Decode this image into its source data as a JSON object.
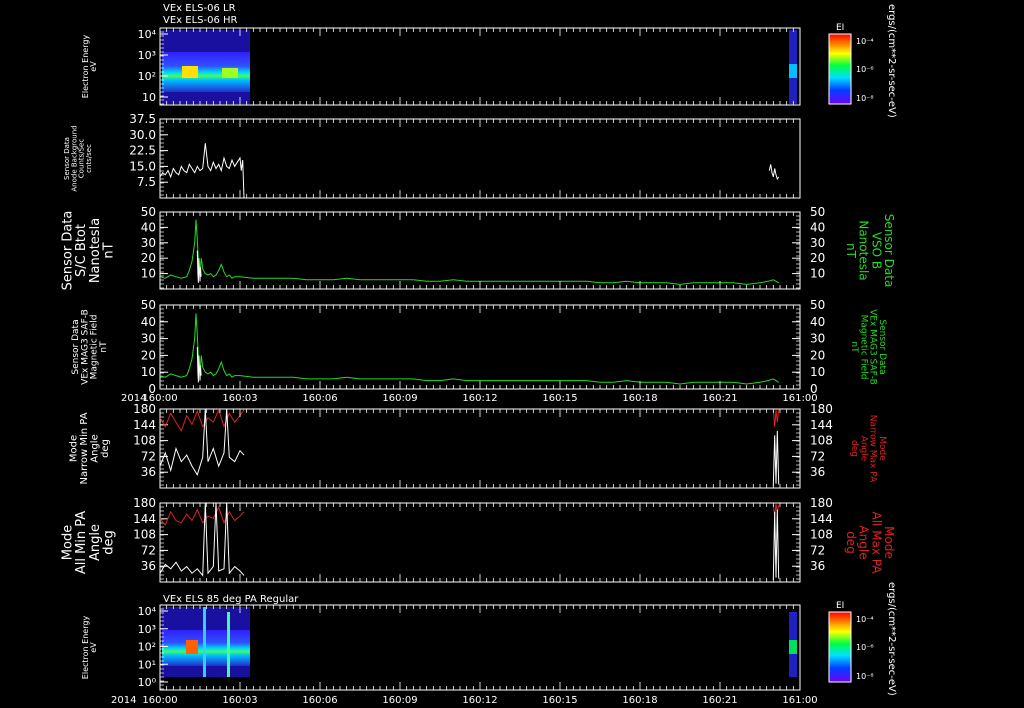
{
  "colors": {
    "background": "#000000",
    "axis": "#ffffff",
    "green": "#22dd22",
    "red": "#dd2222",
    "white": "#ffffff"
  },
  "header": {
    "line1": "VEx ELS-06 LR",
    "line2": "VEx ELS-06 HR"
  },
  "time_axis": {
    "year": "2014",
    "tick_labels": [
      "160:00",
      "160:03",
      "160:06",
      "160:09",
      "160:12",
      "160:15",
      "160:18",
      "160:21",
      "161:00"
    ]
  },
  "colorbar_units": "ergs/(cm**2-sr-sec-eV)",
  "chart_data": [
    {
      "type": "heatmap",
      "id": "els06",
      "ylabel": [
        "Electron Energy",
        "eV"
      ],
      "yticks": [
        "10⁴",
        "10³",
        "10²",
        "10"
      ],
      "colorbar": {
        "label": "EI",
        "ticks": [
          "10⁻⁴",
          "10⁻⁶",
          "10⁻⁸"
        ]
      }
    },
    {
      "type": "line",
      "id": "background",
      "ylabel": [
        "Sensor Data",
        "Anode Background",
        "Counts/Sec",
        "cnts/sec"
      ],
      "ylim": [
        0,
        37.5
      ],
      "yticks": [
        "37.5",
        "30.0",
        "22.5",
        "15.0",
        "7.5"
      ],
      "series": [
        {
          "color": "white",
          "x": [
            0,
            0.1,
            0.2,
            0.3,
            0.4,
            0.5,
            0.6,
            0.7,
            0.8,
            0.9,
            1.0,
            1.1,
            1.2,
            1.3,
            1.4,
            1.5,
            1.6,
            1.7,
            1.8,
            1.9,
            2.0,
            2.1,
            2.2,
            2.3,
            2.4,
            2.5,
            2.6,
            2.7,
            2.8,
            2.9,
            3.0,
            3.05,
            3.1,
            3.15
          ],
          "y": [
            10,
            12,
            11,
            13,
            10,
            14,
            12,
            11,
            15,
            13,
            12,
            16,
            14,
            12,
            15,
            13,
            14,
            26,
            15,
            13,
            17,
            14,
            16,
            13,
            19,
            15,
            14,
            18,
            15,
            17,
            19,
            13,
            18,
            0
          ]
        },
        {
          "color": "white",
          "x": [
            22.85,
            22.9,
            22.95,
            23.0,
            23.05,
            23.1,
            23.15,
            23.2
          ],
          "y": [
            13,
            16,
            12,
            10,
            14,
            11,
            9,
            10
          ]
        }
      ]
    },
    {
      "type": "line",
      "id": "bmag",
      "ylabel": [
        "Sensor Data",
        "S/C Btot",
        "Nanotesla",
        "nT"
      ],
      "ylabel_right": [
        "Sensor Data",
        "VSO B",
        "Nanotesla",
        "nT"
      ],
      "ylim": [
        0,
        50
      ],
      "yticks": [
        "50",
        "40",
        "30",
        "20",
        "10"
      ],
      "series": [
        {
          "color": "green",
          "x": [
            0,
            0.2,
            0.4,
            0.6,
            0.8,
            1.0,
            1.1,
            1.2,
            1.3,
            1.35,
            1.4,
            1.45,
            1.5,
            1.55,
            1.6,
            1.7,
            1.8,
            1.9,
            2.0,
            2.1,
            2.2,
            2.3,
            2.4,
            2.5,
            2.6,
            2.7,
            2.8,
            3.0,
            3.5,
            4,
            4.5,
            5,
            5.5,
            6,
            6.5,
            7,
            7.5,
            8,
            8.5,
            9,
            9.5,
            10,
            10.5,
            11,
            11.5,
            12,
            12.5,
            13,
            13.5,
            14,
            14.5,
            15,
            15.5,
            16,
            16.5,
            17,
            17.5,
            18,
            18.5,
            19,
            19.5,
            20,
            20.5,
            21,
            21.5,
            22,
            22.5,
            22.8,
            23,
            23.2
          ],
          "y": [
            8,
            7,
            9,
            8,
            7,
            8,
            12,
            18,
            30,
            45,
            32,
            15,
            10,
            20,
            13,
            10,
            9,
            10,
            8,
            9,
            12,
            16,
            11,
            8,
            9,
            7,
            8,
            8,
            7,
            7,
            7,
            7,
            6,
            6,
            6,
            7,
            6,
            6,
            6,
            6,
            6,
            5,
            5,
            6,
            5,
            5,
            5,
            5,
            5,
            5,
            5,
            5,
            5,
            5,
            4,
            4,
            5,
            4,
            4,
            4,
            3,
            4,
            4,
            4,
            4,
            3,
            4,
            5,
            6,
            4
          ]
        },
        {
          "color": "white",
          "x": [
            1.4,
            1.42,
            1.44,
            1.46,
            1.48,
            1.5,
            1.52,
            1.54
          ],
          "y": [
            25,
            10,
            4,
            20,
            12,
            5,
            14,
            8
          ]
        }
      ]
    },
    {
      "type": "line",
      "id": "mag3",
      "ylabel": [
        "Sensor Data",
        "VEx MAG3 SAF-B",
        "Magnetic Field",
        "nT"
      ],
      "ylabel_right": [
        "Sensor Data",
        "VEx MAG3 SAF-B",
        "Magnetic Field",
        "nT"
      ],
      "ylim": [
        0,
        50
      ],
      "yticks": [
        "50",
        "40",
        "30",
        "20",
        "10",
        "0"
      ],
      "series": [
        {
          "color": "green",
          "x": [
            0,
            0.2,
            0.4,
            0.6,
            0.8,
            1.0,
            1.1,
            1.2,
            1.3,
            1.35,
            1.4,
            1.45,
            1.5,
            1.55,
            1.6,
            1.7,
            1.8,
            1.9,
            2.0,
            2.1,
            2.2,
            2.3,
            2.4,
            2.5,
            2.6,
            2.7,
            2.8,
            3.0,
            3.5,
            4,
            4.5,
            5,
            5.5,
            6,
            6.5,
            7,
            7.5,
            8,
            8.5,
            9,
            9.5,
            10,
            10.5,
            11,
            11.5,
            12,
            12.5,
            13,
            13.5,
            14,
            14.5,
            15,
            15.5,
            16,
            16.5,
            17,
            17.5,
            18,
            18.5,
            19,
            19.5,
            20,
            20.5,
            21,
            21.5,
            22,
            22.5,
            22.8,
            23,
            23.2
          ],
          "y": [
            8,
            7,
            9,
            8,
            7,
            8,
            12,
            18,
            30,
            45,
            32,
            15,
            10,
            20,
            13,
            10,
            9,
            10,
            8,
            9,
            12,
            16,
            11,
            8,
            9,
            7,
            8,
            8,
            7,
            7,
            7,
            7,
            6,
            6,
            6,
            7,
            6,
            6,
            6,
            6,
            6,
            5,
            5,
            6,
            5,
            5,
            5,
            5,
            5,
            5,
            5,
            5,
            5,
            5,
            4,
            4,
            5,
            4,
            4,
            4,
            3,
            4,
            4,
            4,
            4,
            3,
            4,
            5,
            6,
            4
          ]
        },
        {
          "color": "white",
          "x": [
            1.4,
            1.42,
            1.44,
            1.46,
            1.48,
            1.5,
            1.52,
            1.54
          ],
          "y": [
            25,
            10,
            4,
            20,
            12,
            5,
            14,
            8
          ]
        }
      ]
    },
    {
      "type": "line",
      "id": "narrowpa",
      "ylabel": [
        "Mode",
        "Narrow Min PA",
        "Angle",
        "deg"
      ],
      "ylabel_right": [
        "Mode",
        "Narrow Max PA",
        "Angle",
        "deg"
      ],
      "ylim": [
        0,
        180
      ],
      "yticks": [
        "180",
        "144",
        "108",
        "72",
        "36"
      ],
      "series": [
        {
          "color": "red",
          "x": [
            0,
            0.2,
            0.4,
            0.6,
            0.8,
            1.0,
            1.2,
            1.4,
            1.6,
            1.8,
            2.0,
            2.2,
            2.4,
            2.6,
            2.8,
            3.0,
            3.15
          ],
          "y": [
            160,
            140,
            170,
            150,
            130,
            165,
            145,
            175,
            140,
            160,
            150,
            178,
            140,
            170,
            150,
            165,
            178
          ]
        },
        {
          "color": "white",
          "x": [
            0,
            0.2,
            0.4,
            0.6,
            0.8,
            1.0,
            1.2,
            1.4,
            1.6,
            1.7,
            1.8,
            2.0,
            2.2,
            2.4,
            2.5,
            2.6,
            2.8,
            3.0,
            3.15
          ],
          "y": [
            50,
            80,
            40,
            90,
            60,
            75,
            50,
            30,
            70,
            180,
            60,
            90,
            50,
            80,
            180,
            70,
            60,
            85,
            75
          ]
        },
        {
          "color": "red",
          "x": [
            23.0,
            23.05,
            23.1,
            23.15,
            23.2
          ],
          "y": [
            178,
            140,
            178,
            150,
            178
          ]
        },
        {
          "color": "white",
          "x": [
            23.0,
            23.05,
            23.1,
            23.15,
            23.2
          ],
          "y": [
            5,
            120,
            10,
            130,
            8
          ]
        }
      ]
    },
    {
      "type": "line",
      "id": "allpa",
      "ylabel": [
        "Mode",
        "All Min PA",
        "Angle",
        "deg"
      ],
      "ylabel_right": [
        "Mode",
        "All Max PA",
        "Angle",
        "deg"
      ],
      "ylim": [
        0,
        180
      ],
      "yticks": [
        "180",
        "144",
        "108",
        "72",
        "36"
      ],
      "series": [
        {
          "color": "red",
          "x": [
            0,
            0.2,
            0.4,
            0.6,
            0.8,
            1.0,
            1.2,
            1.4,
            1.6,
            1.8,
            2.0,
            2.2,
            2.4,
            2.6,
            2.8,
            3.0,
            3.15
          ],
          "y": [
            145,
            130,
            160,
            140,
            135,
            155,
            140,
            165,
            135,
            150,
            145,
            170,
            135,
            160,
            140,
            150,
            160
          ]
        },
        {
          "color": "white",
          "x": [
            0,
            0.2,
            0.4,
            0.6,
            0.8,
            1.0,
            1.2,
            1.4,
            1.6,
            1.7,
            1.8,
            2.0,
            2.1,
            2.2,
            2.4,
            2.5,
            2.6,
            2.8,
            3.0,
            3.15
          ],
          "y": [
            20,
            40,
            30,
            45,
            25,
            35,
            20,
            30,
            15,
            180,
            20,
            35,
            180,
            25,
            30,
            180,
            20,
            35,
            25,
            15
          ]
        },
        {
          "color": "red",
          "x": [
            23.0,
            23.05,
            23.1,
            23.15,
            23.2
          ],
          "y": [
            175,
            150,
            178,
            160,
            175
          ]
        },
        {
          "color": "white",
          "x": [
            23.0,
            23.05,
            23.1,
            23.15,
            23.2
          ],
          "y": [
            5,
            160,
            10,
            165,
            8
          ]
        }
      ]
    },
    {
      "type": "heatmap",
      "id": "pa85",
      "title": "VEx ELS 85 deg PA Regular",
      "ylabel": [
        "Electron Energy",
        "eV"
      ],
      "yticks": [
        "10⁴",
        "10³",
        "10²",
        "10¹",
        "10⁰"
      ],
      "colorbar": {
        "label": "EI",
        "ticks": [
          "10⁻⁴",
          "10⁻⁶",
          "10⁻⁸"
        ]
      }
    }
  ]
}
